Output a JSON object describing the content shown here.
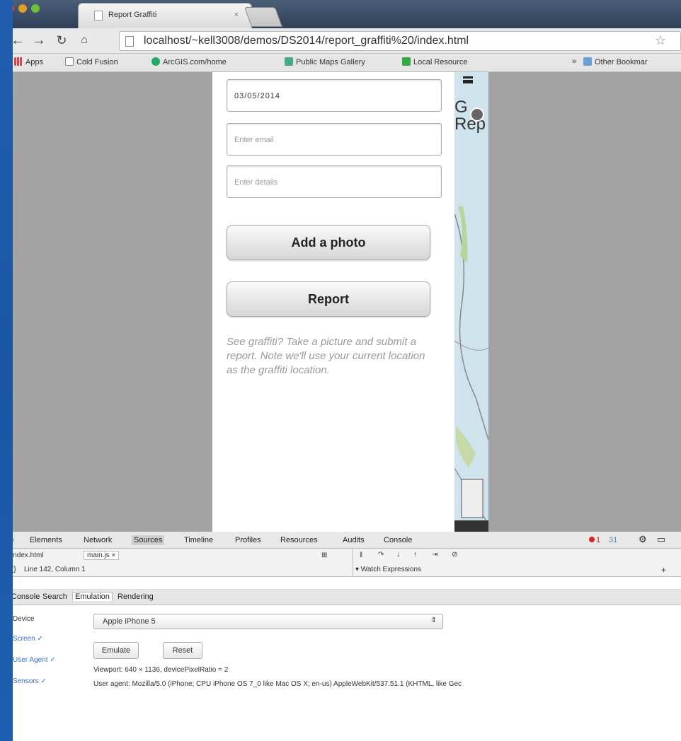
{
  "browser": {
    "tab_title": "Report Graffiti",
    "tab_close": "×",
    "url": "localhost/~kell3008/demos/DS2014/report_graffiti%20/index.html",
    "bookmarks": [
      "Apps",
      "Cold Fusion",
      "ArcGIS.com/home",
      "Public Maps Gallery",
      "Local Resource",
      "Other Bookmar"
    ],
    "bookmarks_chevron": "»"
  },
  "page": {
    "date_value": "03/05/2014",
    "email_placeholder": "Enter email",
    "details_placeholder": "Enter details",
    "add_photo_label": "Add a photo",
    "report_label": "Report",
    "note": "See graffiti? Take a picture and submit a report. Note we'll use your current location as the graffiti location.",
    "map_title": "G\nRep"
  },
  "devtools": {
    "tabs": [
      "Elements",
      "Network",
      "Sources",
      "Timeline",
      "Profiles",
      "Resources",
      "Audits",
      "Console"
    ],
    "selected_tab": "Sources",
    "error_count": "1",
    "warning_count": "31",
    "files": [
      "index.html",
      "main.js ×"
    ],
    "position": "Line 142, Column 1",
    "watch": "▾ Watch Expressions",
    "watch_add": "+",
    "drawer_tabs": [
      "Console",
      "Search",
      "Emulation",
      "Rendering"
    ],
    "emulation": {
      "sidebar": [
        "Device",
        "Screen ✓",
        "User Agent ✓",
        "Sensors ✓"
      ],
      "device": "Apple iPhone 5",
      "emulate_label": "Emulate",
      "reset_label": "Reset",
      "viewport": "Viewport:  640 × 1136, devicePixelRatio = 2",
      "user_agent": "User agent:  Mozilla/5.0 (iPhone; CPU iPhone OS 7_0 like Mac OS X; en-us) AppleWebKit/537.51.1 (KHTML, like Gec"
    }
  },
  "colors": {
    "desktop_blue": "#1a5fb4",
    "viewport_gray": "#a3a3a3",
    "link_blue": "#3b6fd6"
  }
}
